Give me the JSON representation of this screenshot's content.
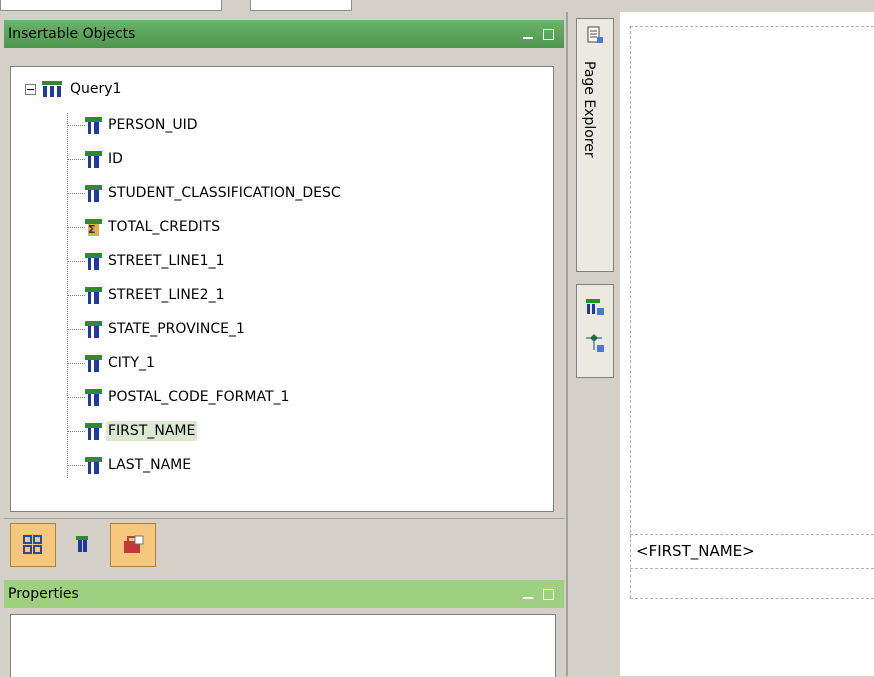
{
  "insertable_panel": {
    "title": "Insertable Objects",
    "tree": {
      "root": "Query1",
      "items": [
        {
          "label": "PERSON_UID",
          "icon": "data-item-icon"
        },
        {
          "label": "ID",
          "icon": "data-item-icon"
        },
        {
          "label": "STUDENT_CLASSIFICATION_DESC",
          "icon": "data-item-icon"
        },
        {
          "label": "TOTAL_CREDITS",
          "icon": "calculated-item-icon"
        },
        {
          "label": "STREET_LINE1_1",
          "icon": "data-item-icon"
        },
        {
          "label": "STREET_LINE2_1",
          "icon": "data-item-icon"
        },
        {
          "label": "STATE_PROVINCE_1",
          "icon": "data-item-icon"
        },
        {
          "label": "CITY_1",
          "icon": "data-item-icon"
        },
        {
          "label": "POSTAL_CODE_FORMAT_1",
          "icon": "data-item-icon"
        },
        {
          "label": "FIRST_NAME",
          "icon": "data-item-icon",
          "selected": true
        },
        {
          "label": "LAST_NAME",
          "icon": "data-item-icon"
        }
      ]
    }
  },
  "properties_panel": {
    "title": "Properties"
  },
  "side_tab": {
    "label": "Page Explorer"
  },
  "canvas": {
    "cell_text": "<FIRST_NAME>"
  },
  "colors": {
    "insertable_header": "#5aa05a",
    "properties_header": "#9fd07f",
    "active_tab": "#f8c77e",
    "selection": "#dce9d2"
  }
}
